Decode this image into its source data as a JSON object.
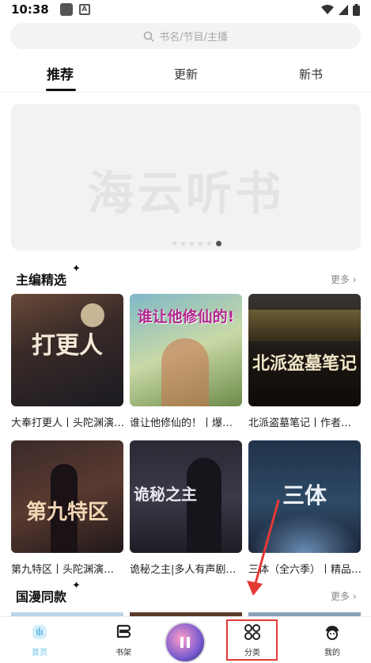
{
  "status": {
    "time": "10:38"
  },
  "search": {
    "placeholder": "书名/节目/主播"
  },
  "tabs": [
    {
      "label": "推荐",
      "active": true
    },
    {
      "label": "更新",
      "active": false
    },
    {
      "label": "新书",
      "active": false
    }
  ],
  "banner": {
    "text": "海云听书"
  },
  "sections": [
    {
      "title": "主编精选",
      "more": "更多",
      "books": [
        {
          "label": "大奉打更人丨头陀渊演…",
          "cover_text": "打更人"
        },
        {
          "label": "谁让他修仙的！丨爆…",
          "cover_text": "谁让他修仙的!"
        },
        {
          "label": "北派盗墓笔记丨作者…",
          "cover_text": "北派盗墓笔记"
        },
        {
          "label": "第九特区丨头陀渊演…",
          "cover_text": "第九特区"
        },
        {
          "label": "诡秘之主|多人有声剧…",
          "cover_text": "诡秘之主"
        },
        {
          "label": "三体（全六季）丨精品…",
          "cover_text": "三体"
        }
      ]
    },
    {
      "title": "国漫同款",
      "more": "更多"
    }
  ],
  "nav": [
    {
      "label": "首页",
      "icon": "home-icon",
      "active": true
    },
    {
      "label": "书架",
      "icon": "bookshelf-icon",
      "active": false
    },
    {
      "label": "分类",
      "icon": "category-icon",
      "active": false,
      "highlighted": true
    },
    {
      "label": "我的",
      "icon": "profile-icon",
      "active": false
    }
  ],
  "colors": {
    "accent": "#6fc1e6",
    "highlight_box": "#e53935"
  }
}
